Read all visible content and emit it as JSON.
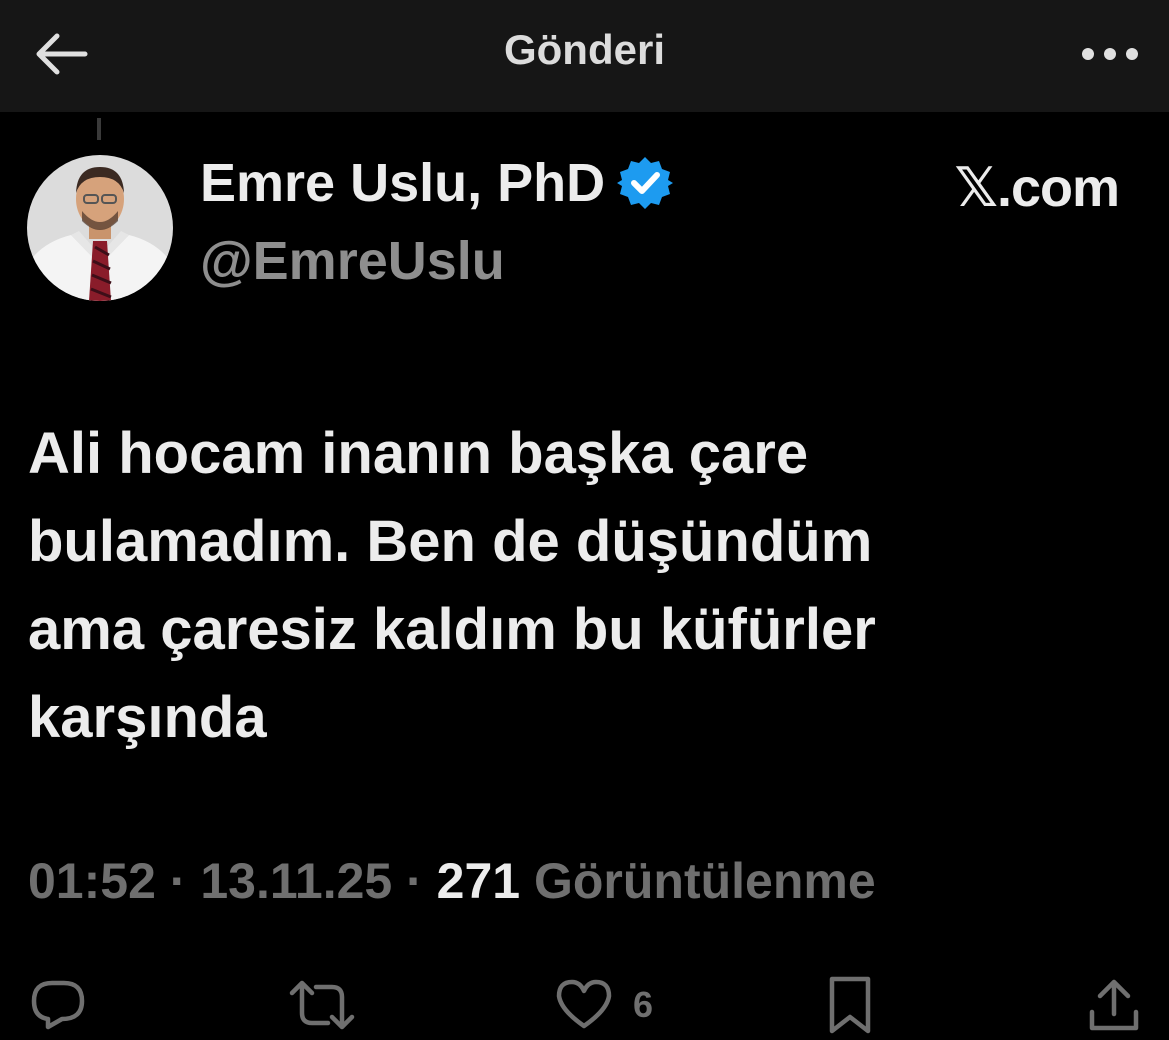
{
  "header": {
    "title": "Gönderi",
    "back_icon": "arrow-left-icon",
    "more_icon": "more-horizontal-icon"
  },
  "author": {
    "display_name": "Emre Uslu, PhD",
    "handle": "@EmreUslu",
    "verified": true,
    "verified_color": "#1d9bf0"
  },
  "source_label": "𝕏.com",
  "tweet": {
    "text": "Ali hocam inanın başka çare\nbulamadım. Ben de düşündüm\nama çaresiz kaldım bu küfürler\nkarşında"
  },
  "meta": {
    "time": "01:52",
    "separator": " · ",
    "date": "13.11.25",
    "views_count": "271",
    "views_label": "Görüntülenme"
  },
  "actions": {
    "reply_icon": "reply-icon",
    "retweet_icon": "retweet-icon",
    "like_icon": "heart-icon",
    "like_count": "6",
    "bookmark_icon": "bookmark-icon",
    "share_icon": "share-icon"
  },
  "colors": {
    "background": "#000000",
    "header_bg": "#161616",
    "primary_text": "#ececec",
    "secondary_text": "#6f6f6f",
    "accent": "#1d9bf0"
  }
}
